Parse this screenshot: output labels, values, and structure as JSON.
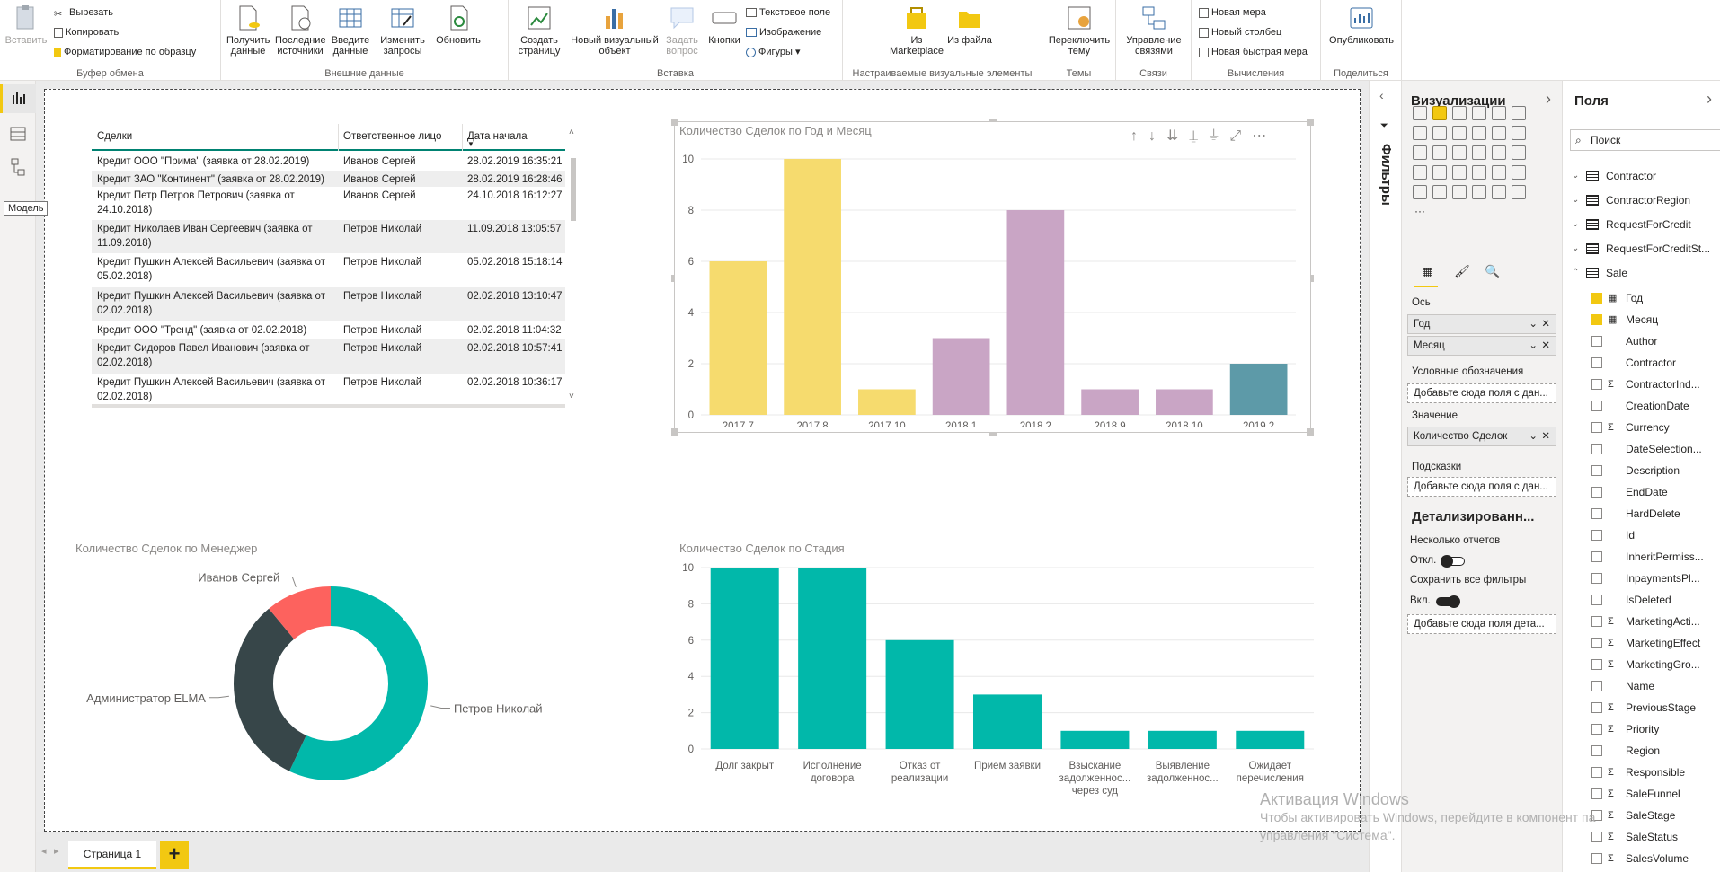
{
  "ribbon": {
    "clipboard": {
      "paste": "Вставить",
      "cut": "Вырезать",
      "copy": "Копировать",
      "format_painter": "Форматирование по образцу",
      "group": "Буфер обмена"
    },
    "external": {
      "get_data": "Получить данные",
      "recent": "Последние источники",
      "enter": "Введите данные",
      "edit": "Изменить запросы",
      "refresh": "Обновить",
      "group": "Внешние данные"
    },
    "insert": {
      "new_page": "Создать страницу",
      "new_visual": "Новый визуальный объект",
      "ask": "Задать вопрос",
      "buttons": "Кнопки",
      "textbox": "Текстовое поле",
      "image": "Изображение",
      "shapes": "Фигуры",
      "group": "Вставка"
    },
    "custom": {
      "marketplace": "Из Marketplace",
      "file": "Из файла",
      "group": "Настраиваемые визуальные элементы"
    },
    "themes": {
      "switch": "Переключить тему",
      "group": "Темы"
    },
    "relations": {
      "manage": "Управление связями",
      "group": "Связи"
    },
    "calc": {
      "new_measure": "Новая мера",
      "new_column": "Новый столбец",
      "quick_measure": "Новая быстрая мера",
      "group": "Вычисления"
    },
    "share": {
      "publish": "Опубликовать",
      "group": "Поделиться"
    }
  },
  "tooltip": "Модель",
  "table": {
    "headers": [
      "Сделки",
      "Ответственное лицо",
      "Дата начала"
    ],
    "rows": [
      {
        "deal": "Кредит ООО \"Прима\" (заявка от 28.02.2019)",
        "person": "Иванов Сергей",
        "date": "28.02.2019 16:35:21"
      },
      {
        "deal": "Кредит ЗАО \"Континент\" (заявка от 28.02.2019)",
        "person": "Иванов Сергей",
        "date": "28.02.2019 16:28:46"
      },
      {
        "deal": "Кредит Петр Петров Петрович (заявка от 24.10.2018)",
        "person": "Иванов Сергей",
        "date": "24.10.2018 16:12:27"
      },
      {
        "deal": "Кредит Николаев Иван Сергеевич (заявка от 11.09.2018)",
        "person": "Петров Николай",
        "date": "11.09.2018 13:05:57"
      },
      {
        "deal": "Кредит Пушкин Алексей Васильевич (заявка от 05.02.2018)",
        "person": "Петров Николай",
        "date": "05.02.2018 15:18:14"
      },
      {
        "deal": "Кредит Пушкин Алексей Васильевич (заявка от 02.02.2018)",
        "person": "Петров Николай",
        "date": "02.02.2018 13:10:47"
      },
      {
        "deal": "Кредит ООО \"Тренд\" (заявка от 02.02.2018)",
        "person": "Петров Николай",
        "date": "02.02.2018 11:04:32"
      },
      {
        "deal": "Кредит Сидоров Павел Иванович (заявка от 02.02.2018)",
        "person": "Петров Николай",
        "date": "02.02.2018 10:57:41"
      },
      {
        "deal": "Кредит Пушкин Алексей Васильевич (заявка от 02.02.2018)",
        "person": "Петров Николай",
        "date": "02.02.2018 10:36:17"
      }
    ]
  },
  "chart_data": [
    {
      "type": "bar",
      "title": "Количество Сделок по Год и Месяц",
      "categories": [
        "2017 7",
        "2017 8",
        "2017 10",
        "2018 1",
        "2018 2",
        "2018 9",
        "2018 10",
        "2019 2"
      ],
      "values": [
        6,
        10,
        1,
        3,
        8,
        1,
        1,
        2
      ],
      "colors": [
        "#f6db6e",
        "#f6db6e",
        "#f6db6e",
        "#c9a5c5",
        "#c9a5c5",
        "#c9a5c5",
        "#c9a5c5",
        "#5d9aa8"
      ],
      "ylim": [
        0,
        10
      ],
      "yticks": [
        0,
        2,
        4,
        6,
        8,
        10
      ],
      "grid": true
    },
    {
      "type": "pie",
      "title": "Количество Сделок по Менеджер",
      "labels": [
        "Петров Николай",
        "Администратор ELMA",
        "Иванов Сергей"
      ],
      "values": [
        57,
        32,
        11
      ],
      "colors": [
        "#01b8aa",
        "#374649",
        "#fd625e"
      ],
      "donut": true
    },
    {
      "type": "bar",
      "title": "Количество Сделок по Стадия",
      "categories": [
        "Долг закрыт",
        "Исполнение договора",
        "Отказ от реализации",
        "Прием заявки",
        "Взыскание задолженнос... через суд",
        "Выявление задолженнос...",
        "Ожидает перечисления"
      ],
      "values": [
        10,
        10,
        6,
        3,
        1,
        1,
        1
      ],
      "color": "#01b8aa",
      "ylim": [
        0,
        10
      ],
      "yticks": [
        0,
        2,
        4,
        6,
        8,
        10
      ],
      "grid": true
    }
  ],
  "filters": {
    "label": "Фильтры"
  },
  "viz": {
    "title": "Визуализации",
    "axis_label": "Ось",
    "axis_fields": [
      "Год",
      "Месяц"
    ],
    "legend_label": "Условные обозначения",
    "add_field": "Добавьте сюда поля с дан...",
    "value_label": "Значение",
    "value_field": "Количество Сделок",
    "tooltips_label": "Подсказки",
    "drill_title": "Детализированн...",
    "multi_reports": "Несколько отчетов",
    "off": "Откл.",
    "keep_filters": "Сохранить все фильтры",
    "on": "Вкл.",
    "drill_add": "Добавьте сюда поля дета..."
  },
  "fields": {
    "title": "Поля",
    "search_placeholder": "Поиск",
    "tables": [
      "Contractor",
      "ContractorRegion",
      "RequestForCredit",
      "RequestForCreditSt...",
      "Sale"
    ],
    "sale_fields": [
      {
        "name": "Год",
        "checked": true,
        "type": "hier"
      },
      {
        "name": "Месяц",
        "checked": true,
        "type": "hier"
      },
      {
        "name": "Author",
        "checked": false,
        "type": ""
      },
      {
        "name": "Contractor",
        "checked": false,
        "type": ""
      },
      {
        "name": "ContractorInd...",
        "checked": false,
        "type": "sum"
      },
      {
        "name": "CreationDate",
        "checked": false,
        "type": ""
      },
      {
        "name": "Currency",
        "checked": false,
        "type": "sum"
      },
      {
        "name": "DateSelection...",
        "checked": false,
        "type": ""
      },
      {
        "name": "Description",
        "checked": false,
        "type": ""
      },
      {
        "name": "EndDate",
        "checked": false,
        "type": ""
      },
      {
        "name": "HardDelete",
        "checked": false,
        "type": ""
      },
      {
        "name": "Id",
        "checked": false,
        "type": ""
      },
      {
        "name": "InheritPermiss...",
        "checked": false,
        "type": ""
      },
      {
        "name": "InpaymentsPl...",
        "checked": false,
        "type": ""
      },
      {
        "name": "IsDeleted",
        "checked": false,
        "type": ""
      },
      {
        "name": "MarketingActi...",
        "checked": false,
        "type": "sum"
      },
      {
        "name": "MarketingEffect",
        "checked": false,
        "type": "sum"
      },
      {
        "name": "MarketingGro...",
        "checked": false,
        "type": "sum"
      },
      {
        "name": "Name",
        "checked": false,
        "type": ""
      },
      {
        "name": "PreviousStage",
        "checked": false,
        "type": "sum"
      },
      {
        "name": "Priority",
        "checked": false,
        "type": "sum"
      },
      {
        "name": "Region",
        "checked": false,
        "type": ""
      },
      {
        "name": "Responsible",
        "checked": false,
        "type": "sum"
      },
      {
        "name": "SaleFunnel",
        "checked": false,
        "type": "sum"
      },
      {
        "name": "SaleStage",
        "checked": false,
        "type": "sum"
      },
      {
        "name": "SaleStatus",
        "checked": false,
        "type": "sum"
      },
      {
        "name": "SalesVolume",
        "checked": false,
        "type": "sum"
      }
    ]
  },
  "pages": {
    "tab1": "Страница 1",
    "add": "+"
  },
  "watermark": {
    "line1": "Активация Windows",
    "line2": "Чтобы активировать Windows, перейдите в компонент па",
    "line3": "управления \"Система\"."
  }
}
